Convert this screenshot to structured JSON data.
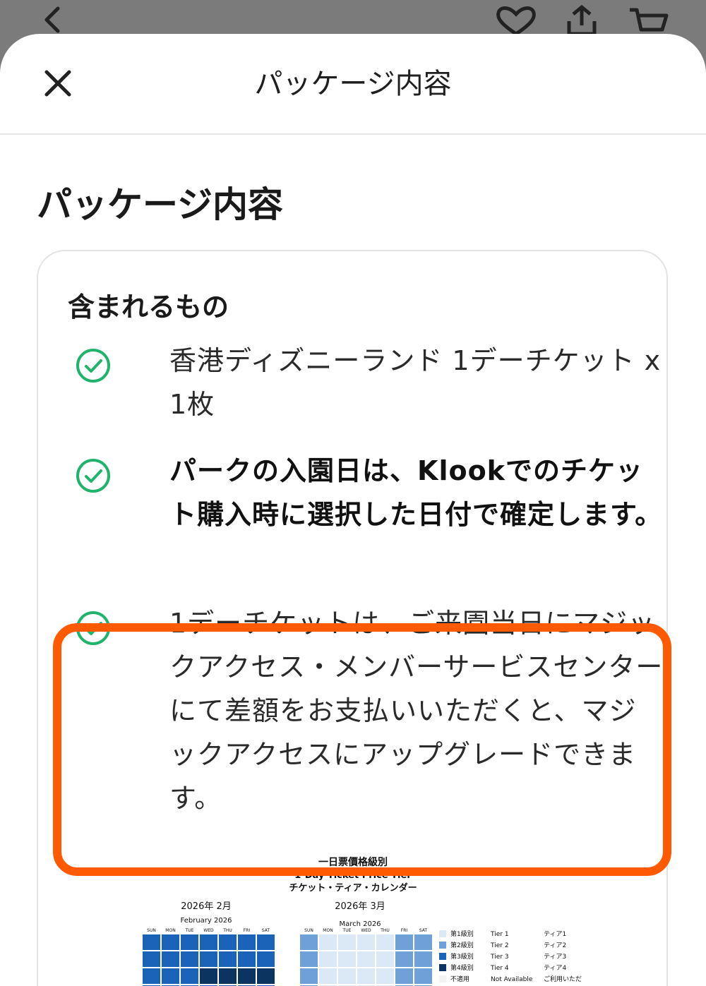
{
  "sheet": {
    "title": "パッケージ内容",
    "section_title": "パッケージ内容",
    "included_heading": "含まれるもの"
  },
  "items": [
    {
      "text": "香港ディズニーランド 1デーチケット x 1枚",
      "bold": false
    },
    {
      "text": "パークの入園日は、Klookでのチケット購入時に選択した日付で確定します。",
      "bold": true
    },
    {
      "text": "1デーチケットは、ご来園当日にマジックアクセス・メンバーサービスセンターにて差額をお支払いいただくと、マジックアクセスにアップグレードできます。",
      "bold": false,
      "highlighted": true
    }
  ],
  "price_tier_image": {
    "title_cn": "一日票價格級別",
    "title_en": "1-Day Ticket Price Tier",
    "title_jp": "チケット・ティア・カレンダー",
    "feb_title": "2026年 2月",
    "feb_sub": "February 2026",
    "mar_title": "2026年 3月",
    "mar_sub": "March 2026",
    "days": [
      "SUN",
      "MON",
      "TUE",
      "WED",
      "THU",
      "FRI",
      "SAT"
    ],
    "legend": [
      {
        "cn": "第1級別",
        "en": "Tier 1",
        "jp": "ティア1"
      },
      {
        "cn": "第2級別",
        "en": "Tier 2",
        "jp": "ティア2"
      },
      {
        "cn": "第3級別",
        "en": "Tier 3",
        "jp": "ティア3"
      },
      {
        "cn": "第4級別",
        "en": "Tier 4",
        "jp": "ティア4"
      },
      {
        "cn": "不適用",
        "en": "Not Available",
        "jp": "ご利用いただ"
      }
    ]
  },
  "colors": {
    "check_green": "#1fb36b",
    "highlight_orange": "#ff5a00",
    "tier1": "#dbe8f5",
    "tier2": "#6fa1d8",
    "tier3": "#1a63b8",
    "tier4": "#0b3560"
  }
}
